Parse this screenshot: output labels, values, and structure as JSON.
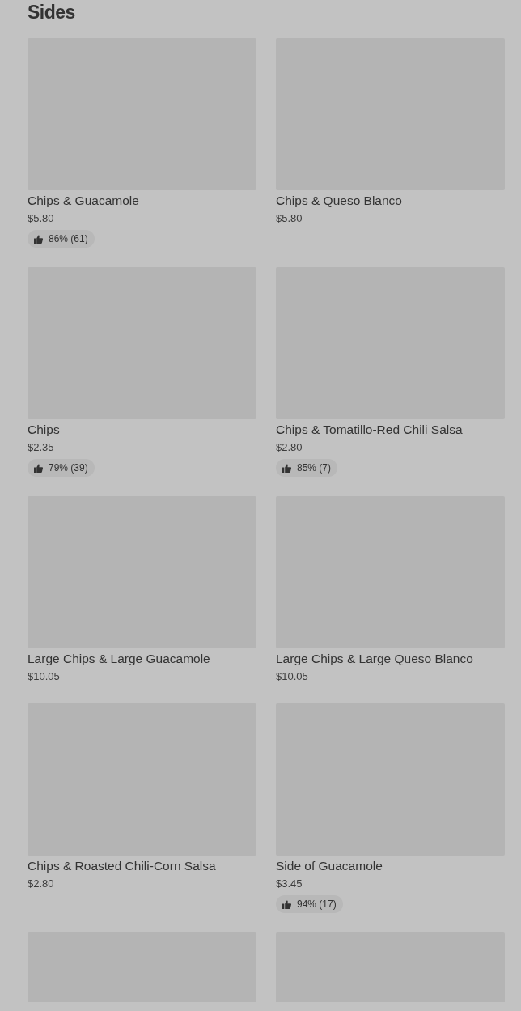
{
  "section": {
    "title": "Sides"
  },
  "items": [
    {
      "kind": "product",
      "name": "Chips & Guacamole",
      "price": "$5.80",
      "rating": "86% (61)"
    },
    {
      "kind": "product",
      "name": "Chips & Queso Blanco",
      "price": "$5.80"
    },
    {
      "kind": "product",
      "name": "Chips",
      "price": "$2.35",
      "rating": "79% (39)"
    },
    {
      "kind": "product",
      "name": "Chips & Tomatillo-Red Chili Salsa",
      "price": "$2.80",
      "rating": "85% (7)"
    },
    {
      "kind": "product",
      "name": "Large Chips & Large Guacamole",
      "price": "$10.05"
    },
    {
      "kind": "product",
      "name": "Large Chips & Large Queso Blanco",
      "price": "$10.05"
    },
    {
      "kind": "product",
      "name": "Chips & Roasted Chili-Corn Salsa",
      "price": "$2.80"
    },
    {
      "kind": "product",
      "name": "Side of Guacamole",
      "price": "$3.45",
      "rating": "94% (17)"
    },
    {
      "kind": "image_only"
    },
    {
      "kind": "image_only"
    }
  ]
}
